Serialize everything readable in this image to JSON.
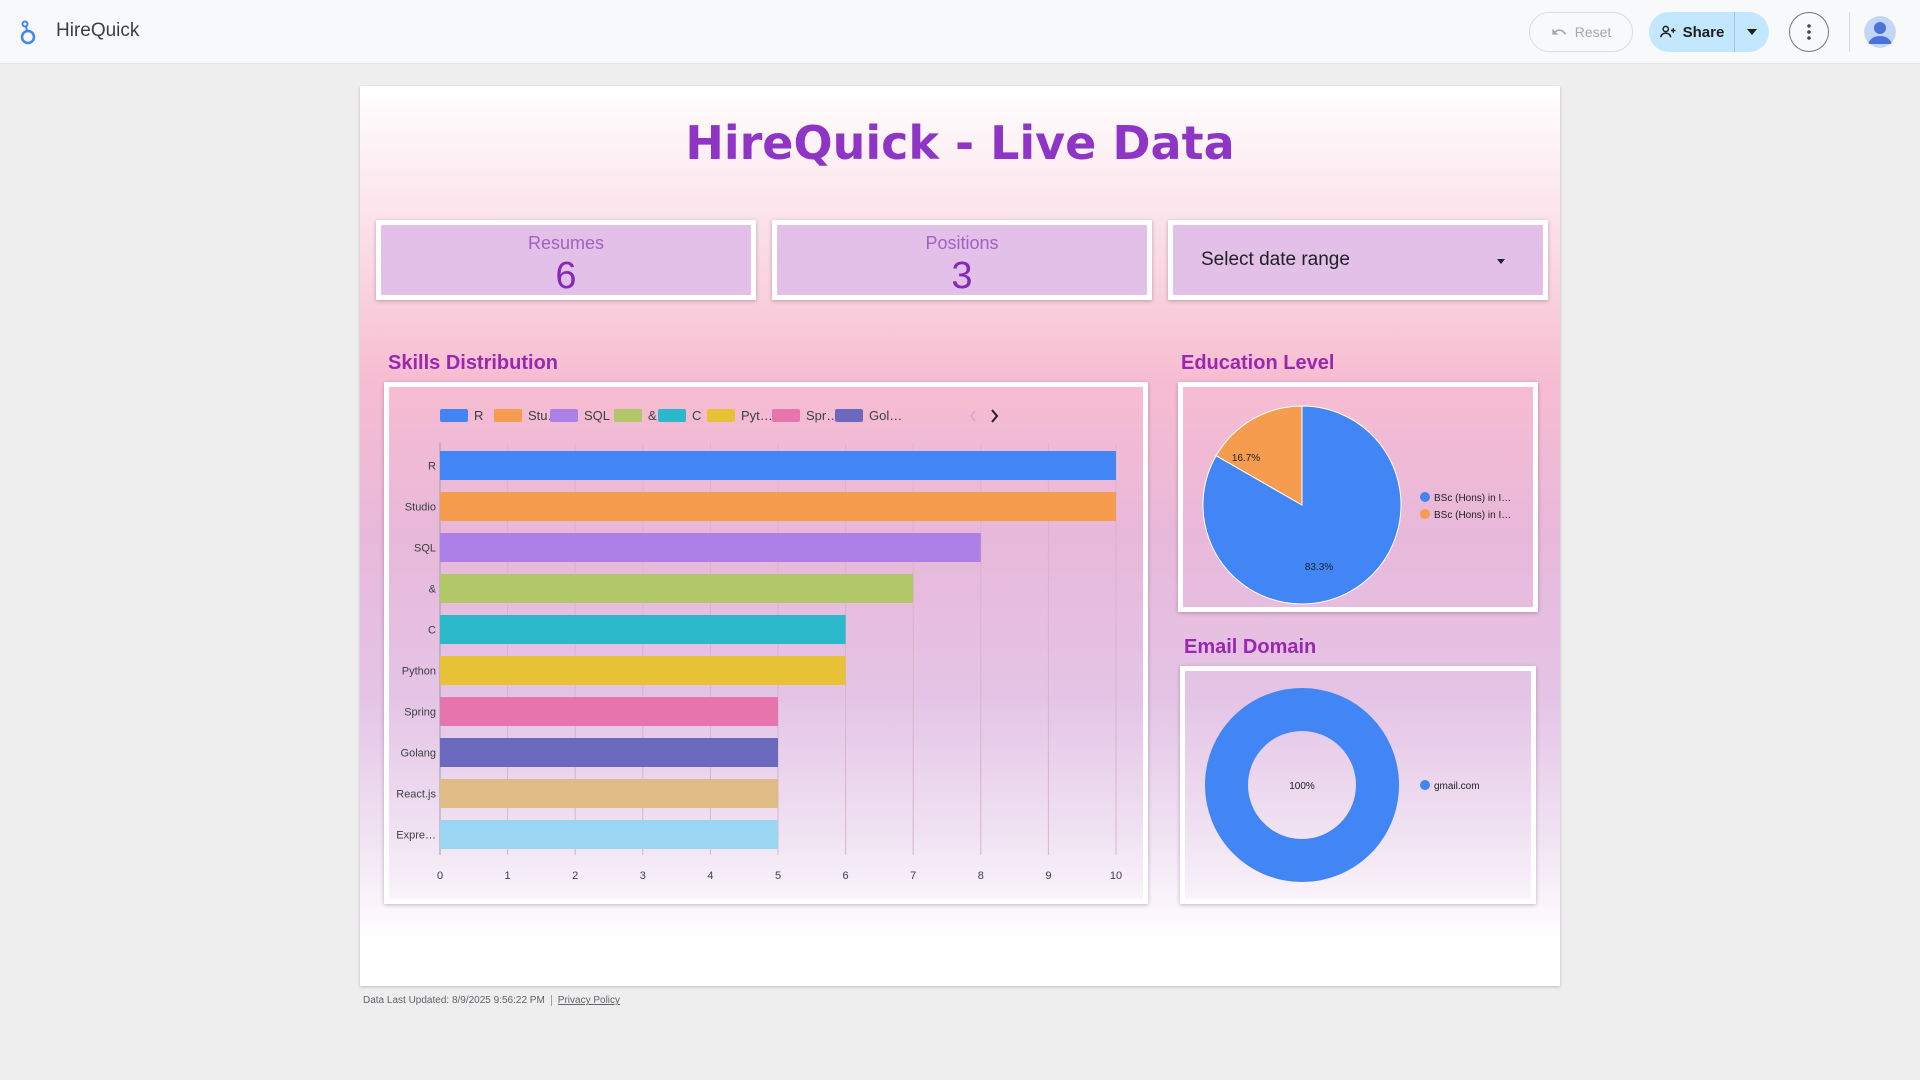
{
  "app": {
    "title": "HireQuick",
    "reset_label": "Reset",
    "share_label": "Share",
    "icons": [
      "looker-logo-icon",
      "undo-icon",
      "person-add-icon",
      "caret-down-icon",
      "more-vert-icon",
      "avatar-icon"
    ]
  },
  "report": {
    "title": "HireQuick - Live Data",
    "kpis": [
      {
        "label": "Resumes",
        "value": "6"
      },
      {
        "label": "Positions",
        "value": "3"
      }
    ],
    "date_range_label": "Select date range"
  },
  "sections": {
    "skills": "Skills Distribution",
    "education": "Education Level",
    "email": "Email Domain"
  },
  "footer": {
    "updated": "Data Last Updated: 8/9/2025 9:56:22 PM",
    "privacy": "Privacy Policy"
  },
  "chart_data": [
    {
      "type": "bar",
      "orientation": "horizontal",
      "title": "Skills Distribution",
      "categories": [
        "R",
        "Studio",
        "SQL",
        "&",
        "C",
        "Python",
        "Spring",
        "Golang",
        "React.js",
        "Expre…"
      ],
      "values": [
        10,
        10,
        8,
        7,
        6,
        6,
        5,
        5,
        5,
        5
      ],
      "colors": [
        "#4285f4",
        "#f59c4f",
        "#ad80e8",
        "#b2c767",
        "#2bb8cb",
        "#e8c236",
        "#e675ad",
        "#6a69bd",
        "#dfbb86",
        "#9ad6f2"
      ],
      "legend": [
        "R",
        "Stu…",
        "SQL",
        "&",
        "C",
        "Pyt…",
        "Spr…",
        "Gol…"
      ],
      "legend_position": "top",
      "xlim": [
        0,
        10
      ],
      "xticks": [
        "0",
        "1",
        "2",
        "3",
        "4",
        "5",
        "6",
        "7",
        "8",
        "9",
        "10"
      ],
      "grid": true
    },
    {
      "type": "pie",
      "title": "Education Level",
      "labels": [
        "BSc (Hons) in I…",
        "BSc (Hons) in I…"
      ],
      "values": [
        83.3,
        16.7
      ],
      "data_labels": [
        "83.3%",
        "16.7%"
      ],
      "colors": [
        "#4285f4",
        "#f59c4f"
      ],
      "legend_position": "right"
    },
    {
      "type": "pie",
      "variant": "donut",
      "title": "Email Domain",
      "labels": [
        "gmail.com"
      ],
      "values": [
        100
      ],
      "data_labels": [
        "100%"
      ],
      "colors": [
        "#4285f4"
      ],
      "legend_position": "right"
    }
  ]
}
